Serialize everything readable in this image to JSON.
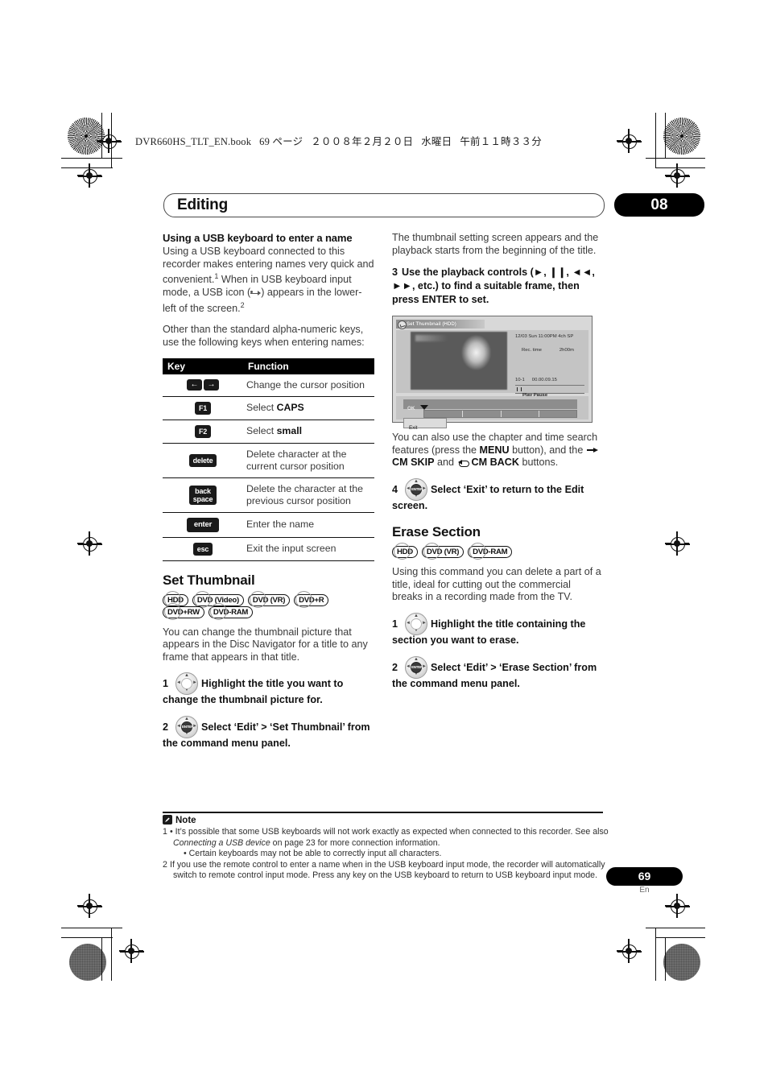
{
  "running_header": {
    "file": "DVR660HS_TLT_EN.book",
    "page_label": "69 ページ",
    "date": "２００８年２月２０日",
    "weekday": "水曜日",
    "time": "午前１１時３３分"
  },
  "chapter": {
    "title": "Editing",
    "number": "08"
  },
  "left_column": {
    "usb_heading": "Using a USB keyboard to enter a name",
    "usb_para_a": "Using a USB keyboard connected to this recorder makes entering names very quick and convenient.",
    "usb_sup1": "1",
    "usb_para_b": " When in USB keyboard input mode, a USB icon (",
    "usb_para_c": ") appears in the lower-left of the screen.",
    "usb_sup2": "2",
    "usb_para_d": "Other than the standard alpha-numeric keys, use the following keys when entering names:",
    "key_table": {
      "headers": [
        "Key",
        "Function"
      ],
      "rows": [
        {
          "key_type": "arrows",
          "key_labels": [
            "←",
            "→"
          ],
          "function": "Change the cursor position"
        },
        {
          "key_type": "cap",
          "key_labels": [
            "F1"
          ],
          "function_prefix": "Select ",
          "function_bold": "CAPS"
        },
        {
          "key_type": "cap",
          "key_labels": [
            "F2"
          ],
          "function_prefix": "Select ",
          "function_bold": "small"
        },
        {
          "key_type": "cap",
          "key_labels": [
            "delete"
          ],
          "function": "Delete character at the current cursor position"
        },
        {
          "key_type": "cap2",
          "key_labels": [
            "back",
            "space"
          ],
          "function": "Delete the character at the previous cursor position"
        },
        {
          "key_type": "wide",
          "key_labels": [
            "enter"
          ],
          "function": "Enter the name"
        },
        {
          "key_type": "cap",
          "key_labels": [
            "esc"
          ],
          "function": "Exit the input screen"
        }
      ]
    },
    "set_thumbnail": {
      "heading": "Set Thumbnail",
      "badges": [
        "HDD",
        "DVD (Video)",
        "DVD (VR)",
        "DVD+R",
        "DVD+RW",
        "DVD-RAM"
      ],
      "paragraph": "You can change the thumbnail picture that appears in the Disc Navigator for a title to any frame that appears in that title.",
      "steps": [
        {
          "n": "1",
          "control": "jog",
          "text": "Highlight the title you want to change the thumbnail picture for."
        },
        {
          "n": "2",
          "control": "enter",
          "text": "Select ‘Edit’ > ‘Set Thumbnail’ from the command menu panel."
        }
      ]
    }
  },
  "right_column": {
    "intro_para": "The thumbnail setting screen appears and the playback starts from the beginning of the title.",
    "step3": {
      "n": "3",
      "text_a": "Use the playback controls (",
      "icon_play": "►",
      "sep1": ", ",
      "icon_pause": "❙❙",
      "sep2": ", ",
      "icon_rew": "◄◄",
      "sep3": ", ",
      "icon_ff": "►►",
      "text_b": ", etc.) to find a suitable frame, then press ENTER to set."
    },
    "screenshot": {
      "title": "Set Thumbnail  (HDD)",
      "rec_line": "12/03 Sun 11:00PM 4ch   SP",
      "rec_time_label": "Rec. time",
      "rec_time_value": "2h00m",
      "chapter_no": "10-1",
      "timecode": "00.00.09.15",
      "play_state": "Play Pause",
      "ok_label": "OK",
      "exit_label": "Exit"
    },
    "after_shot_para_a": "You can also use the chapter and time search features (press the ",
    "after_shot_menu": "MENU",
    "after_shot_para_b": " button), and the ",
    "cm_skip": "CM SKIP",
    "after_shot_and": " and ",
    "cm_back": "CM BACK",
    "after_shot_para_c": " buttons.",
    "step4": {
      "n": "4",
      "control": "enter",
      "text": "Select ‘Exit’ to return to the Edit screen."
    },
    "erase_section": {
      "heading": "Erase Section",
      "badges": [
        "HDD",
        "DVD (VR)",
        "DVD-RAM"
      ],
      "paragraph": "Using this command you can delete a part of a title, ideal for cutting out the commercial breaks in a recording made from the TV.",
      "steps": [
        {
          "n": "1",
          "control": "jog",
          "text": "Highlight the title containing the section you want to erase."
        },
        {
          "n": "2",
          "control": "enter",
          "text": "Select ‘Edit’ > ‘Erase Section’ from the command menu panel."
        }
      ]
    }
  },
  "note": {
    "heading": "Note",
    "items": [
      {
        "num": "1",
        "text_a": "• It’s possible that some USB keyboards will not work exactly as expected when connected to this recorder. See also ",
        "italic": "Connecting a USB device",
        "text_b": " on page 23 for more connection information.",
        "bullet2": "• Certain keyboards may not be able to correctly input all characters."
      },
      {
        "num": "2",
        "text_a": "If you use the remote control to enter a name when in the USB keyboard input mode, the recorder will automatically switch to remote control input mode. Press any key on the USB keyboard to return to USB keyboard input mode."
      }
    ]
  },
  "footer": {
    "page_number": "69",
    "language": "En"
  },
  "colors": {
    "ink": "#1b1b1b",
    "body_text": "#3a3a3a",
    "black_bar": "#000000",
    "screen_bg": "#c4c4c4"
  }
}
